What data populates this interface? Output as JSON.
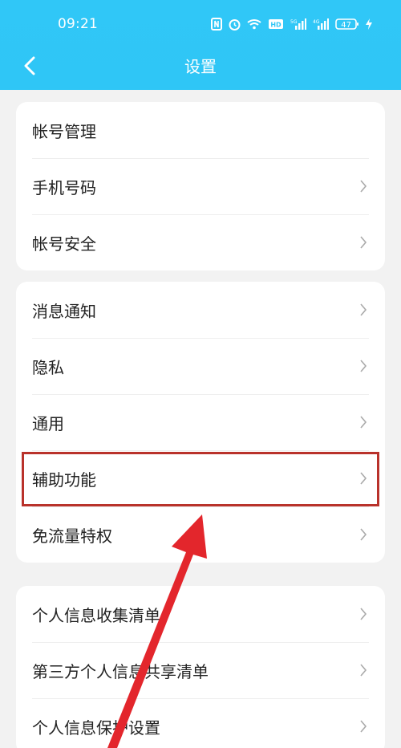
{
  "status_bar": {
    "time": "09:21",
    "battery": "47"
  },
  "nav": {
    "title": "设置"
  },
  "groups": [
    {
      "items": [
        {
          "label": "帐号管理"
        },
        {
          "label": "手机号码"
        },
        {
          "label": "帐号安全"
        }
      ]
    },
    {
      "items": [
        {
          "label": "消息通知"
        },
        {
          "label": "隐私"
        },
        {
          "label": "通用"
        },
        {
          "label": "辅助功能"
        },
        {
          "label": "免流量特权"
        }
      ]
    },
    {
      "items": [
        {
          "label": "个人信息收集清单"
        },
        {
          "label": "第三方个人信息共享清单"
        },
        {
          "label": "个人信息保护设置"
        }
      ]
    }
  ],
  "annotation": {
    "highlight_color": "#b9322b",
    "arrow_color": "#e3262c"
  },
  "colors": {
    "header": "#2fc6f6",
    "background": "#f2f2f2"
  }
}
